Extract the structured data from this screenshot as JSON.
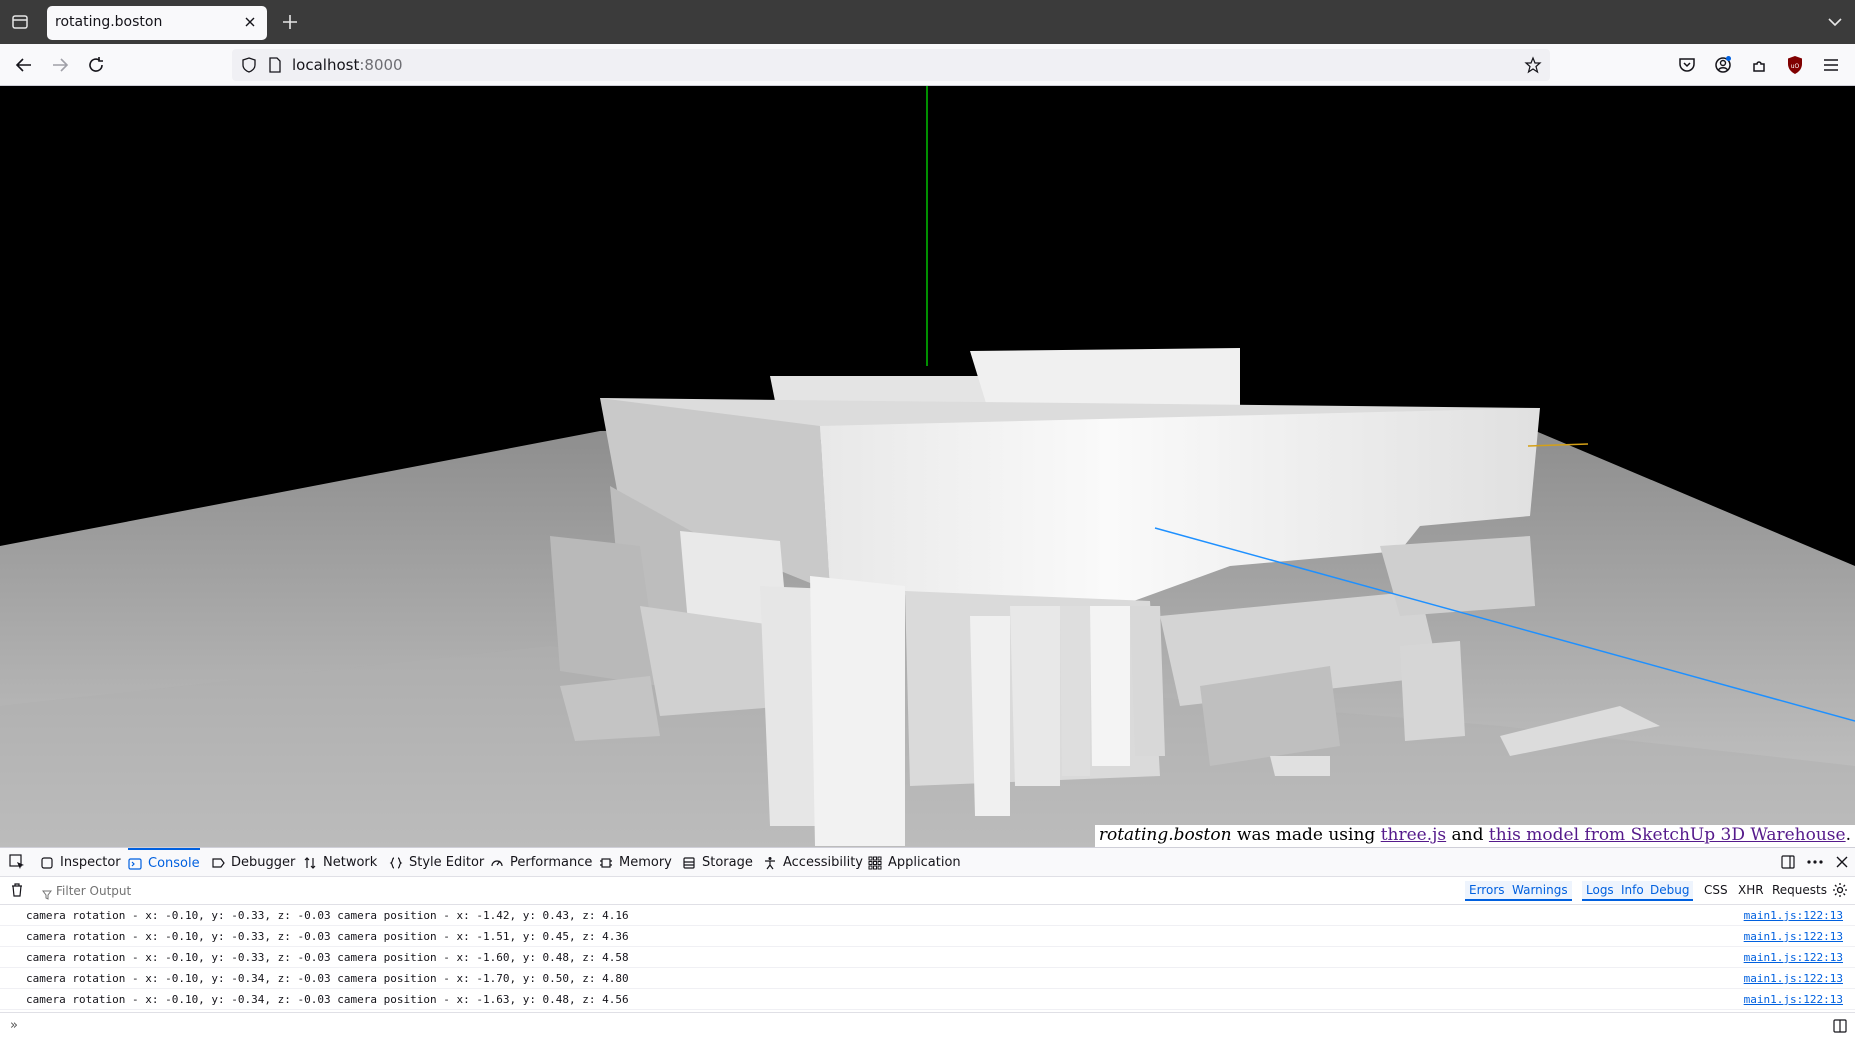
{
  "browser": {
    "tab_title": "rotating.boston",
    "url_host": "localhost",
    "url_port": ":8000"
  },
  "page": {
    "credit": {
      "site_name": "rotating.boston",
      "text_made": " was made using ",
      "link1": "three.js",
      "text_and": " and ",
      "link2": "this model from SketchUp 3D Warehouse",
      "text_end": "."
    }
  },
  "devtools": {
    "tabs": [
      {
        "label": "Inspector",
        "icon": "inspector-icon"
      },
      {
        "label": "Console",
        "icon": "console-icon"
      },
      {
        "label": "Debugger",
        "icon": "debugger-icon"
      },
      {
        "label": "Network",
        "icon": "network-icon"
      },
      {
        "label": "Style Editor",
        "icon": "style-editor-icon"
      },
      {
        "label": "Performance",
        "icon": "performance-icon"
      },
      {
        "label": "Memory",
        "icon": "memory-icon"
      },
      {
        "label": "Storage",
        "icon": "storage-icon"
      },
      {
        "label": "Accessibility",
        "icon": "accessibility-icon"
      },
      {
        "label": "Application",
        "icon": "application-icon"
      }
    ],
    "active_tab": "Console",
    "filter_placeholder": "Filter Output",
    "filters": {
      "errors": "Errors",
      "warnings": "Warnings",
      "logs": "Logs",
      "info": "Info",
      "debug": "Debug",
      "css": "CSS",
      "xhr": "XHR",
      "requests": "Requests"
    },
    "console_rows": [
      {
        "message": "camera rotation - x: -0.10, y: -0.33, z: -0.03 camera position - x: -1.42, y: 0.43, z: 4.16",
        "source": "main1.js:122:13"
      },
      {
        "message": "camera rotation - x: -0.10, y: -0.33, z: -0.03 camera position - x: -1.51, y: 0.45, z: 4.36",
        "source": "main1.js:122:13"
      },
      {
        "message": "camera rotation - x: -0.10, y: -0.33, z: -0.03 camera position - x: -1.60, y: 0.48, z: 4.58",
        "source": "main1.js:122:13"
      },
      {
        "message": "camera rotation - x: -0.10, y: -0.34, z: -0.03 camera position - x: -1.70, y: 0.50, z: 4.80",
        "source": "main1.js:122:13"
      },
      {
        "message": "camera rotation - x: -0.10, y: -0.34, z: -0.03 camera position - x: -1.63, y: 0.48, z: 4.56",
        "source": "main1.js:122:13"
      }
    ],
    "prompt_symbol": "»"
  },
  "colors": {
    "accent": "#0060df",
    "tabstrip": "#3b3b3b",
    "axis_y": "#00c000",
    "axis_z": "#1e90ff",
    "axis_x": "#d4a017"
  }
}
